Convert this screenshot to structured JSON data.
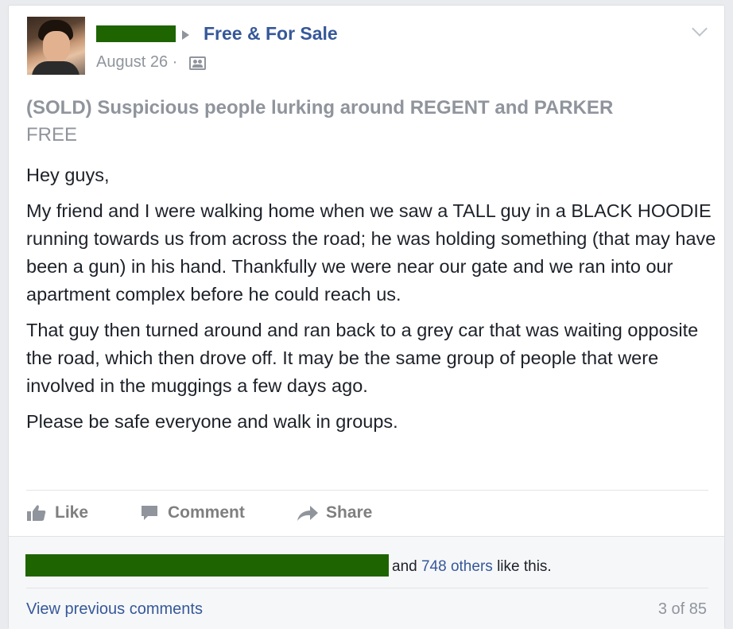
{
  "post": {
    "group_name": "Free & For Sale",
    "date": "August 26 ·",
    "title": "(SOLD) Suspicious people lurking around REGENT and PARKER",
    "price": "FREE",
    "paragraphs": [
      "Hey guys,",
      "My friend and I were walking home when we saw a TALL guy in a BLACK HOODIE running towards us from across the road; he was holding something (that may have been a gun) in his hand. Thankfully we were near our gate and we ran into our apartment complex before he could reach us.",
      "That guy then turned around and ran back to a grey car that was waiting opposite the road, which then drove off. It may be the same group of people that were involved in the muggings a few days ago.",
      "Please be safe everyone and walk in groups."
    ]
  },
  "actions": {
    "like": "Like",
    "comment": "Comment",
    "share": "Share"
  },
  "likes": {
    "prefix": "and",
    "others_link": "748 others",
    "suffix": "like this."
  },
  "comments": {
    "view_previous": "View previous comments",
    "count": "3 of 85"
  },
  "colors": {
    "link": "#365899",
    "muted": "#90949c",
    "redaction": "#1e6400"
  },
  "icons": [
    "chevron-down-icon",
    "members-icon",
    "like-icon",
    "comment-icon",
    "share-icon",
    "caret-right-icon"
  ]
}
